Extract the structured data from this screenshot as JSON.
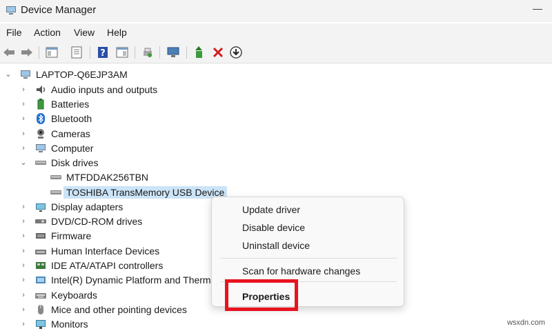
{
  "window": {
    "title": "Device Manager"
  },
  "menu": [
    "File",
    "Action",
    "View",
    "Help"
  ],
  "tree": {
    "root": "LAPTOP-Q6EJP3AM",
    "items": [
      {
        "label": "Audio inputs and outputs",
        "icon": "speaker-icon"
      },
      {
        "label": "Batteries",
        "icon": "battery-icon"
      },
      {
        "label": "Bluetooth",
        "icon": "bluetooth-icon"
      },
      {
        "label": "Cameras",
        "icon": "camera-icon"
      },
      {
        "label": "Computer",
        "icon": "computer-icon"
      },
      {
        "label": "Disk drives",
        "icon": "disk-drive-icon"
      },
      {
        "label": "MTFDDAK256TBN",
        "icon": "disk-drive-icon"
      },
      {
        "label": "TOSHIBA TransMemory USB Device",
        "icon": "disk-drive-icon"
      },
      {
        "label": "Display adapters",
        "icon": "display-adapter-icon"
      },
      {
        "label": "DVD/CD-ROM drives",
        "icon": "dvd-drive-icon"
      },
      {
        "label": "Firmware",
        "icon": "firmware-icon"
      },
      {
        "label": "Human Interface Devices",
        "icon": "hid-icon"
      },
      {
        "label": "IDE ATA/ATAPI controllers",
        "icon": "ide-controller-icon"
      },
      {
        "label": "Intel(R) Dynamic Platform and Therma",
        "icon": "intel-platform-icon"
      },
      {
        "label": "Keyboards",
        "icon": "keyboard-icon"
      },
      {
        "label": "Mice and other pointing devices",
        "icon": "mouse-icon"
      },
      {
        "label": "Monitors",
        "icon": "monitor-icon"
      }
    ]
  },
  "context_menu": {
    "update": "Update driver",
    "disable": "Disable device",
    "uninstall": "Uninstall device",
    "scan": "Scan for hardware changes",
    "properties": "Properties"
  },
  "watermark": "wsxdn.com",
  "colors": {
    "selection": "#cce4f7",
    "highlight": "#e8131f",
    "chrome": "#f3f3f3"
  }
}
